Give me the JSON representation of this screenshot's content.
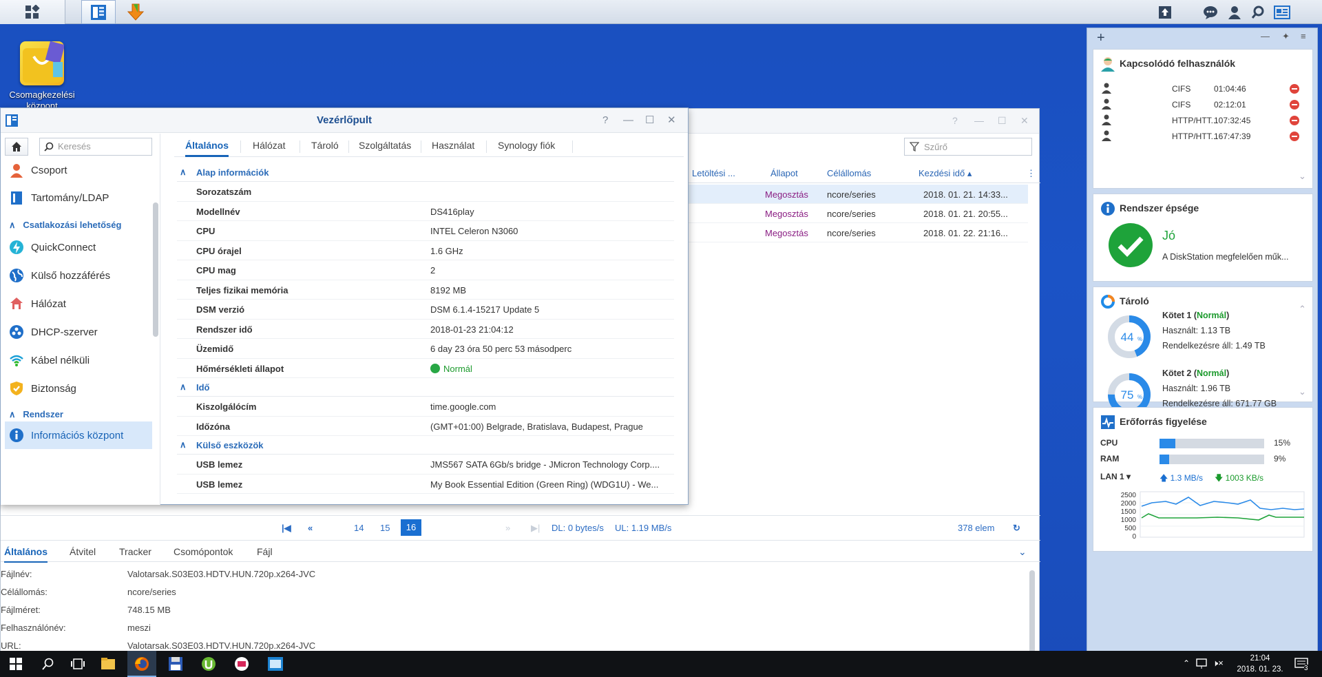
{
  "desktop": {
    "icon_label_line1": "Csomagkezelési",
    "icon_label_line2": "központ"
  },
  "background_window": {
    "filter_placeholder": "Szűrő",
    "columns": [
      "Letöltési ...",
      "Állapot",
      "Célállomás",
      "Kezdési idő"
    ],
    "rows": [
      {
        "status": "Megosztás",
        "dest": "ncore/series",
        "start": "2018. 01. 21. 14:33..."
      },
      {
        "status": "Megosztás",
        "dest": "ncore/series",
        "start": "2018. 01. 21. 20:55..."
      },
      {
        "status": "Megosztás",
        "dest": "ncore/series",
        "start": "2018. 01. 22. 21:16..."
      }
    ],
    "pager": {
      "pages": [
        "14",
        "15",
        "16"
      ],
      "dl": "DL: 0 bytes/s",
      "ul": "UL: 1.19 MB/s",
      "count": "378 elem"
    },
    "bottom_tabs": [
      "Általános",
      "Átvitel",
      "Tracker",
      "Csomópontok",
      "Fájl"
    ],
    "details": [
      {
        "k": "Fájlnév:",
        "v": "Valotarsak.S03E03.HDTV.HUN.720p.x264-JVC"
      },
      {
        "k": "Célállomás:",
        "v": "ncore/series"
      },
      {
        "k": "Fájlméret:",
        "v": "748.15 MB"
      },
      {
        "k": "Felhasználónév:",
        "v": "meszi"
      },
      {
        "k": "URL:",
        "v": "Valotarsak.S03E03.HDTV.HUN.720p.x264-JVC"
      }
    ]
  },
  "control_panel": {
    "title": "Vezérlőpult",
    "search_placeholder": "Keresés",
    "sidebar": {
      "items": [
        {
          "label": "Csoport"
        },
        {
          "label": "Tartomány/LDAP"
        },
        {
          "group": "Csatlakozási lehetőség"
        },
        {
          "label": "QuickConnect"
        },
        {
          "label": "Külső hozzáférés"
        },
        {
          "label": "Hálózat"
        },
        {
          "label": "DHCP-szerver"
        },
        {
          "label": "Kábel nélküli"
        },
        {
          "label": "Biztonság"
        },
        {
          "group": "Rendszer"
        },
        {
          "label": "Információs központ"
        }
      ]
    },
    "tabs": [
      "Általános",
      "Hálózat",
      "Tároló",
      "Szolgáltatás",
      "Használat",
      "Synology fiók"
    ],
    "sections": {
      "basic": "Alap információk",
      "time": "Idő",
      "external": "Külső eszközök"
    },
    "basic_rows": [
      {
        "k": "Sorozatszám",
        "v": ""
      },
      {
        "k": "Modellnév",
        "v": "DS416play"
      },
      {
        "k": "CPU",
        "v": "INTEL Celeron N3060"
      },
      {
        "k": "CPU órajel",
        "v": "1.6 GHz"
      },
      {
        "k": "CPU mag",
        "v": "2"
      },
      {
        "k": "Teljes fizikai memória",
        "v": "8192 MB"
      },
      {
        "k": "DSM verzió",
        "v": "DSM 6.1.4-15217 Update 5"
      },
      {
        "k": "Rendszer idő",
        "v": "2018-01-23 21:04:12"
      },
      {
        "k": "Üzemidő",
        "v": "6 day 23 óra 50 perc 53 másodperc"
      },
      {
        "k": "Hőmérsékleti állapot",
        "v": "Normál"
      }
    ],
    "time_rows": [
      {
        "k": "Kiszolgálócím",
        "v": "time.google.com"
      },
      {
        "k": "Időzóna",
        "v": "(GMT+01:00) Belgrade, Bratislava, Budapest, Prague"
      }
    ],
    "external_rows": [
      {
        "k": "USB lemez",
        "v": "JMS567 SATA 6Gb/s bridge - JMicron Technology Corp...."
      },
      {
        "k": "USB lemez",
        "v": "My Book Essential Edition (Green Ring) (WDG1U) - We..."
      }
    ]
  },
  "widgets": {
    "users": {
      "title": "Kapcsolódó felhasználók",
      "rows": [
        {
          "proto": "CIFS",
          "time": "01:04:46"
        },
        {
          "proto": "CIFS",
          "time": "02:12:01"
        },
        {
          "proto": "HTTP/HTT...",
          "time": "107:32:45"
        },
        {
          "proto": "HTTP/HTT...",
          "time": "167:47:39"
        }
      ]
    },
    "health": {
      "title": "Rendszer épsége",
      "status": "Jó",
      "message": "A DiskStation megfelelően műk..."
    },
    "storage": {
      "title": "Tároló",
      "volumes": [
        {
          "name": "Kötet 1 (",
          "state": "Normál",
          "close": ")",
          "used": "Használt: 1.13 TB",
          "avail": "Rendelkezésre áll: 1.49 TB",
          "pct": "44",
          "pct_value": 44
        },
        {
          "name": "Kötet 2 (",
          "state": "Normál",
          "close": ")",
          "used": "Használt: 1.96 TB",
          "avail": "Rendelkezésre áll: 671.77 GB",
          "pct": "75",
          "pct_value": 75
        }
      ]
    },
    "resources": {
      "title": "Erőforrás figyelése",
      "cpu_label": "CPU",
      "cpu_value": "15%",
      "cpu_pct": 15,
      "ram_label": "RAM",
      "ram_value": "9%",
      "ram_pct": 9,
      "lan_label": "LAN 1",
      "up": "1.3 MB/s",
      "down": "1003 KB/s",
      "y_ticks": [
        "2500",
        "2000",
        "1500",
        "1000",
        "500",
        "0"
      ]
    }
  },
  "windows_taskbar": {
    "time": "21:04",
    "date": "2018. 01. 23.",
    "badge": "3"
  },
  "colors": {
    "accent": "#1764b8",
    "desktop": "#1b53c6",
    "status_purple": "#8a1e83",
    "ok_green": "#28a745"
  }
}
